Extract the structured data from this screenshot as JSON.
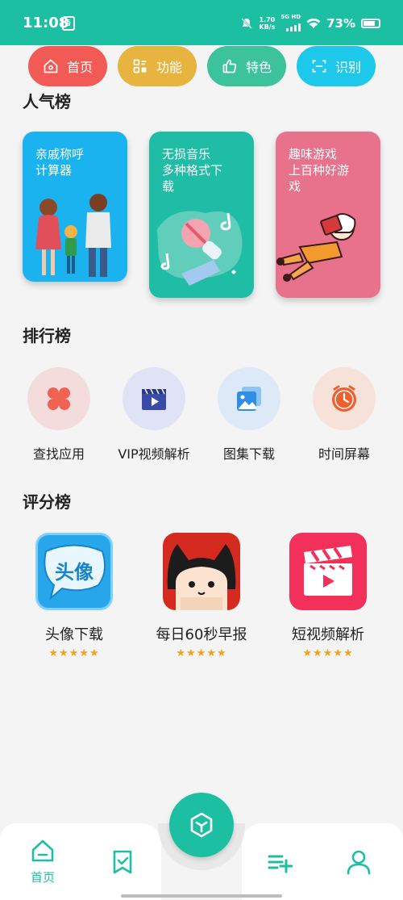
{
  "status_bar": {
    "time": "11:08",
    "notif_glyph": "§",
    "speed_value": "1.70",
    "speed_unit": "KB/s",
    "network": "5G HD",
    "battery": "73%"
  },
  "top_chips": [
    {
      "label": "首页",
      "icon": "home-icon",
      "color": "#f25a55"
    },
    {
      "label": "功能",
      "icon": "grid-icon",
      "color": "#e6b43f"
    },
    {
      "label": "特色",
      "icon": "thumb-up-icon",
      "color": "#3dc39b"
    },
    {
      "label": "识别",
      "icon": "scan-icon",
      "color": "#1ec8ea"
    }
  ],
  "popular": {
    "title": "人气榜",
    "cards": [
      {
        "title": "亲戚称呼\n计算器",
        "color": "#1ab3ef",
        "icon": "family-illustration"
      },
      {
        "title": "无损音乐\n多种格式下\n载",
        "color": "#20bda6",
        "icon": "microphone-illustration"
      },
      {
        "title": "趣味游戏\n上百种好游\n戏",
        "color": "#e8728b",
        "icon": "girl-reading-illustration"
      }
    ]
  },
  "ranking": {
    "title": "排行榜",
    "items": [
      {
        "label": "查找应用",
        "icon": "clover-icon",
        "bg": "#f5dcdc",
        "color": "#f06352"
      },
      {
        "label": "VIP视频解析",
        "icon": "video-icon",
        "bg": "#e0e2f5",
        "color": "#3a4aa8"
      },
      {
        "label": "图集下载",
        "icon": "gallery-icon",
        "bg": "#dde9f7",
        "color": "#2f8fe6"
      },
      {
        "label": "时间屏幕",
        "icon": "clock-icon",
        "bg": "#f7e2da",
        "color": "#f0602e"
      }
    ]
  },
  "rating": {
    "title": "评分榜",
    "items": [
      {
        "label": "头像下载",
        "icon": "avatar-app-icon",
        "icon_text": "头像",
        "stars": "★★★★★"
      },
      {
        "label": "每日60秒早报",
        "icon": "news-cat-app-icon",
        "stars": "★★★★★"
      },
      {
        "label": "短视频解析",
        "icon": "clapperboard-app-icon",
        "stars": "★★★★★"
      }
    ]
  },
  "bottom_nav": {
    "home_label": "首页",
    "accent": "#1cbfa2"
  }
}
